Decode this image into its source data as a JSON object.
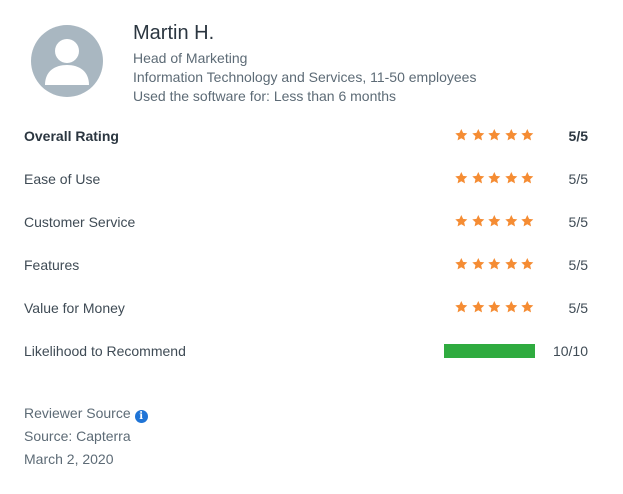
{
  "reviewer": {
    "name": "Martin H.",
    "title": "Head of Marketing",
    "company": "Information Technology and Services, 11-50 employees",
    "usage": "Used the software for: Less than 6 months"
  },
  "ratings": [
    {
      "label": "Overall Rating",
      "stars": 5,
      "score": "5/5"
    },
    {
      "label": "Ease of Use",
      "stars": 5,
      "score": "5/5"
    },
    {
      "label": "Customer Service",
      "stars": 5,
      "score": "5/5"
    },
    {
      "label": "Features",
      "stars": 5,
      "score": "5/5"
    },
    {
      "label": "Value for Money",
      "stars": 5,
      "score": "5/5"
    }
  ],
  "recommend": {
    "label": "Likelihood to Recommend",
    "value": 10,
    "max": 10,
    "score": "10/10"
  },
  "source": {
    "title": "Reviewer Source",
    "source": "Source: Capterra",
    "date": "March 2, 2020"
  },
  "colors": {
    "star": "#f58c33",
    "bar": "#2fab3f",
    "info": "#1f74d6",
    "avatar": "#a9b7c1"
  },
  "icons": {
    "avatar": "user-silhouette-icon",
    "info": "info-icon",
    "star": "star-icon"
  }
}
